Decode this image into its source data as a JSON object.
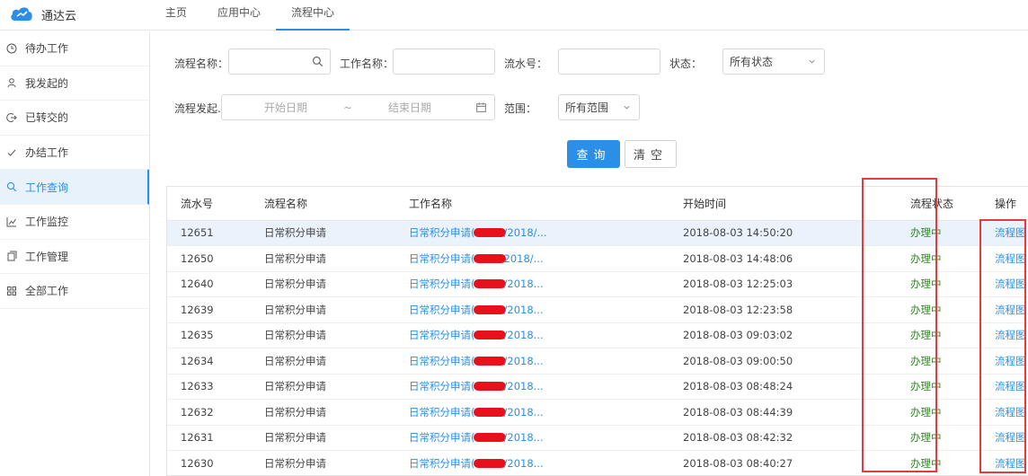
{
  "app": {
    "name": "通达云"
  },
  "topnav": [
    {
      "label": "主页",
      "active": false
    },
    {
      "label": "应用中心",
      "active": false
    },
    {
      "label": "流程中心",
      "active": true
    }
  ],
  "sidebar": [
    {
      "label": "待办工作",
      "icon": "clock-icon",
      "active": false
    },
    {
      "label": "我发起的",
      "icon": "user-icon",
      "active": false
    },
    {
      "label": "已转交的",
      "icon": "forward-icon",
      "active": false
    },
    {
      "label": "办结工作",
      "icon": "check-icon",
      "active": false
    },
    {
      "label": "工作查询",
      "icon": "search-icon",
      "active": true
    },
    {
      "label": "工作监控",
      "icon": "chart-icon",
      "active": false
    },
    {
      "label": "工作管理",
      "icon": "files-icon",
      "active": false
    },
    {
      "label": "全部工作",
      "icon": "grid-icon",
      "active": false
    }
  ],
  "filters": {
    "flow_name_label": "流程名称：",
    "flow_name_value": "",
    "work_name_label": "工作名称：",
    "work_name_value": "",
    "serial_label": "流水号：",
    "serial_value": "",
    "status_label": "状态：",
    "status_value": "所有状态",
    "initiator_label": "流程发起...",
    "date_start_placeholder": "开始日期",
    "date_separator": "~",
    "date_end_placeholder": "结束日期",
    "scope_label": "范围：",
    "scope_value": "所有范围",
    "query_button": "查询",
    "clear_button": "清空"
  },
  "table": {
    "columns": [
      "流水号",
      "流程名称",
      "工作名称",
      "开始时间",
      "流程状态",
      "操作"
    ],
    "rows": [
      {
        "serial": "12651",
        "flow": "日常积分申请",
        "work_prefix": "日常积分申请(",
        "work_suffix": "/2018/...",
        "start": "2018-08-03 14:50:20",
        "status": "办理中",
        "action": "流程图"
      },
      {
        "serial": "12650",
        "flow": "日常积分申请",
        "work_prefix": "日常积分申请(",
        "work_suffix": "2018/...",
        "start": "2018-08-03 14:48:06",
        "status": "办理中",
        "action": "流程图"
      },
      {
        "serial": "12640",
        "flow": "日常积分申请",
        "work_prefix": "日常积分申请(",
        "work_suffix": "/2018...",
        "start": "2018-08-03 12:25:03",
        "status": "办理中",
        "action": "流程图"
      },
      {
        "serial": "12639",
        "flow": "日常积分申请",
        "work_prefix": "日常积分申请(",
        "work_suffix": "/2018...",
        "start": "2018-08-03 12:23:58",
        "status": "办理中",
        "action": "流程图"
      },
      {
        "serial": "12635",
        "flow": "日常积分申请",
        "work_prefix": "日常积分申请(",
        "work_suffix": "/2018...",
        "start": "2018-08-03 09:03:02",
        "status": "办理中",
        "action": "流程图"
      },
      {
        "serial": "12634",
        "flow": "日常积分申请",
        "work_prefix": "日常积分申请(",
        "work_suffix": "/2018...",
        "start": "2018-08-03 09:00:50",
        "status": "办理中",
        "action": "流程图"
      },
      {
        "serial": "12633",
        "flow": "日常积分申请",
        "work_prefix": "日常积分申请(",
        "work_suffix": "/2018...",
        "start": "2018-08-03 08:48:24",
        "status": "办理中",
        "action": "流程图"
      },
      {
        "serial": "12632",
        "flow": "日常积分申请",
        "work_prefix": "日常积分申请(",
        "work_suffix": "/2018...",
        "start": "2018-08-03 08:44:39",
        "status": "办理中",
        "action": "流程图"
      },
      {
        "serial": "12631",
        "flow": "日常积分申请",
        "work_prefix": "日常积分申请(",
        "work_suffix": "/2018...",
        "start": "2018-08-03 08:42:32",
        "status": "办理中",
        "action": "流程图"
      },
      {
        "serial": "12630",
        "flow": "日常积分申请",
        "work_prefix": "日常积分申请(",
        "work_suffix": "/2018...",
        "start": "2018-08-03 08:40:27",
        "status": "办理中",
        "action": "流程图"
      }
    ]
  },
  "colors": {
    "accent": "#2b8fe8",
    "status_green": "#2c8a1e",
    "annotation_red": "#e83a3a",
    "redaction_red": "#e8101a"
  }
}
